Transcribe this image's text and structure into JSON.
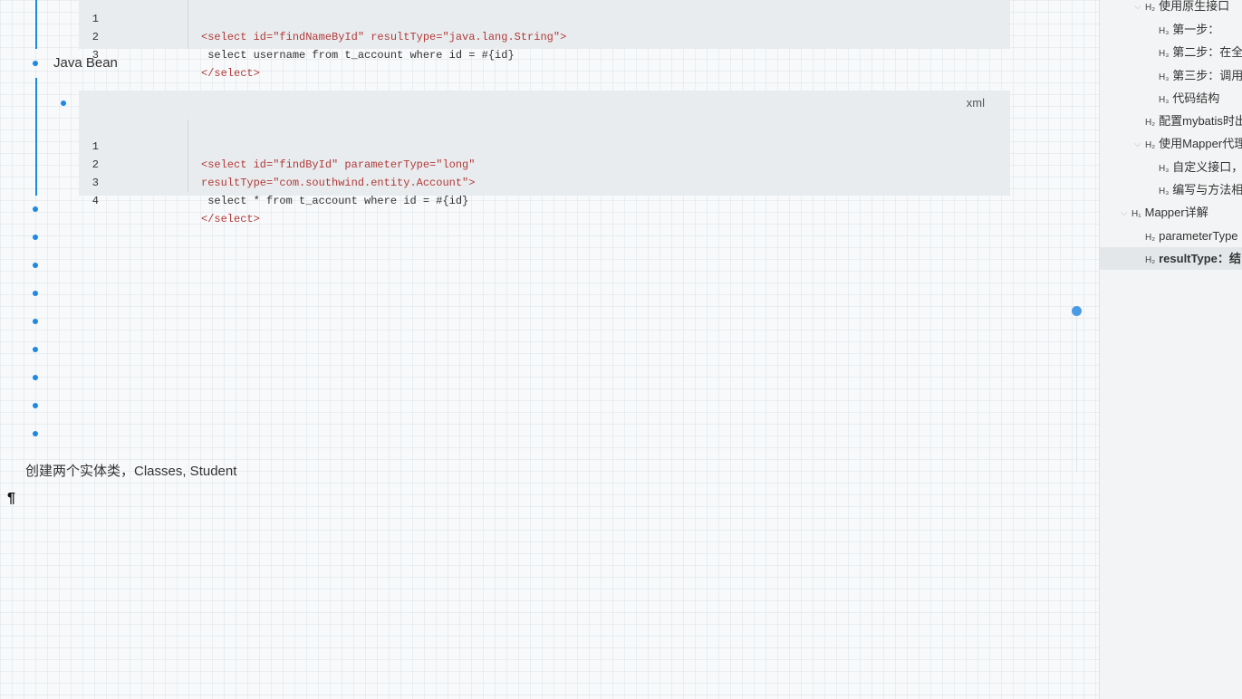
{
  "editor": {
    "code_block_1": {
      "lines": [
        {
          "num": "1",
          "text": "<select id=\"findNameById\" resultType=\"java.lang.String\">"
        },
        {
          "num": "2",
          "text": " select username from t_account where id = #{id}"
        },
        {
          "num": "3",
          "text": "</select>"
        }
      ]
    },
    "java_bean_label": "Java Bean",
    "code_block_2": {
      "language": "xml",
      "lines": [
        {
          "num": "1",
          "text": "<select id=\"findById\" parameterType=\"long\""
        },
        {
          "num": "2",
          "text": "resultType=\"com.southwind.entity.Account\">"
        },
        {
          "num": "3",
          "text": " select * from t_account where id = #{id}"
        },
        {
          "num": "4",
          "text": "</select>"
        }
      ]
    },
    "paragraph": "创建两个实体类，Classes, Student",
    "pilcrow": "¶"
  },
  "toc": {
    "items": [
      {
        "level": "H2",
        "text": "使用原生接口",
        "expanded": true
      },
      {
        "level": "H3",
        "text": "第一步："
      },
      {
        "level": "H3",
        "text": "第二步：在全"
      },
      {
        "level": "H3",
        "text": "第三步：调用"
      },
      {
        "level": "H3",
        "text": "代码结构"
      },
      {
        "level": "H2",
        "text": "配置mybatis时出"
      },
      {
        "level": "H2",
        "text": "使用Mapper代理",
        "expanded": true
      },
      {
        "level": "H3",
        "text": "自定义接口，"
      },
      {
        "level": "H3",
        "text": "编写与方法相"
      },
      {
        "level": "H1",
        "text": "Mapper详解",
        "expanded": true
      },
      {
        "level": "H2",
        "text": "parameterType"
      },
      {
        "level": "H2",
        "text": "resultType：结",
        "active": true
      }
    ]
  },
  "colors": {
    "accent": "#1e88e5",
    "code_bg": "#e8ecee",
    "tag": "#b23a3a"
  }
}
